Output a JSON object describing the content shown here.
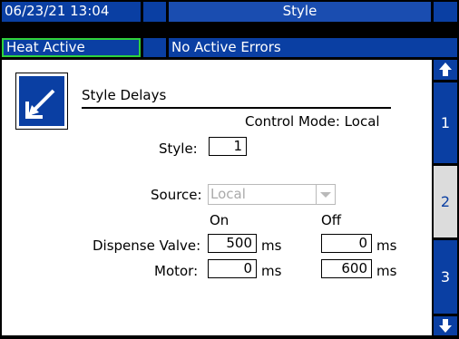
{
  "header": {
    "datetime": "06/23/21 13:04",
    "screen_title": "Style",
    "status": "Heat Active",
    "errors": "No Active Errors"
  },
  "panel": {
    "title": "Style Delays",
    "control_mode": "Control Mode: Local",
    "style_label": "Style:",
    "style_value": "1",
    "source_label": "Source:",
    "source_value": "Local",
    "col_on": "On",
    "col_off": "Off",
    "rows": [
      {
        "label": "Dispense Valve:",
        "on": "500",
        "off": "0",
        "unit": "ms"
      },
      {
        "label": "Motor:",
        "on": "0",
        "off": "600",
        "unit": "ms"
      }
    ]
  },
  "sidebar": {
    "pages": [
      "1",
      "2",
      "3"
    ],
    "selected_page": "2"
  },
  "colors": {
    "accent": "#0a3fa3",
    "status_border": "#2fd23c",
    "selected_tab": "#dcdcdc"
  },
  "icons": [
    "edit-icon",
    "scroll-up-arrow-icon",
    "scroll-down-arrow-icon",
    "dropdown-arrow-icon"
  ]
}
